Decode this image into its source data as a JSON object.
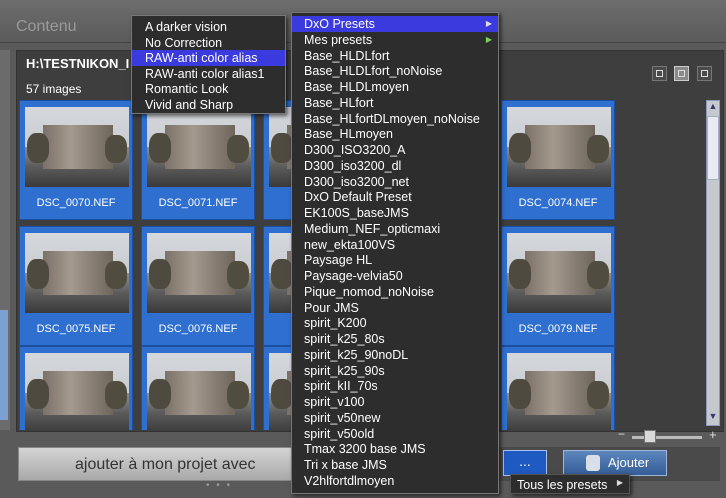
{
  "header": {
    "title": "Contenu"
  },
  "content": {
    "path": "H:\\TESTNIKON_I",
    "image_count": "57 images"
  },
  "view_icons": [
    "grid-small-icon",
    "grid-large-icon",
    "list-view-icon"
  ],
  "thumbnails": [
    [
      "DSC_0070.NEF",
      "DSC_0071.NEF",
      "",
      "",
      "DSC_0074.NEF"
    ],
    [
      "DSC_0075.NEF",
      "DSC_0076.NEF",
      "",
      "",
      "DSC_0079.NEF"
    ],
    [
      "",
      "",
      "",
      "",
      ""
    ]
  ],
  "bottom": {
    "add_project_label": "ajouter à mon projet avec",
    "dots_label": "...",
    "ajouter_label": "Ajouter"
  },
  "presets_submenu": {
    "items": [
      "A darker vision",
      "No Correction",
      "RAW-anti color alias",
      "RAW-anti color alias1",
      "Romantic Look",
      "Vivid and Sharp"
    ],
    "selected_index": 2
  },
  "presets_menu": {
    "items": [
      "DxO Presets",
      "Mes presets",
      "Base_HLDLfort",
      "Base_HLDLfort_noNoise",
      "Base_HLDLmoyen",
      "Base_HLfort",
      "Base_HLfortDLmoyen_noNoise",
      "Base_HLmoyen",
      "D300_ISO3200_A",
      "D300_iso3200_dl",
      "D300_iso3200_net",
      "DxO Default Preset",
      "EK100S_baseJMS",
      "Medium_NEF_opticmaxi",
      "new_ekta100VS",
      "Paysage HL",
      "Paysage-velvia50",
      "Pique_nomod_noNoise",
      "Pour JMS",
      "spirit_K200",
      "spirit_k25_80s",
      "spirit_k25_90noDL",
      "spirit_k25_90s",
      "spirit_kII_70s",
      "spirit_v100",
      "spirit_v50new",
      "spirit_v50old",
      "Tmax 3200 base JMS",
      "Tri x base JMS",
      "V2hlfortdlmoyen"
    ],
    "selected_index": 0
  },
  "tous_presets": {
    "label": "Tous les presets"
  }
}
